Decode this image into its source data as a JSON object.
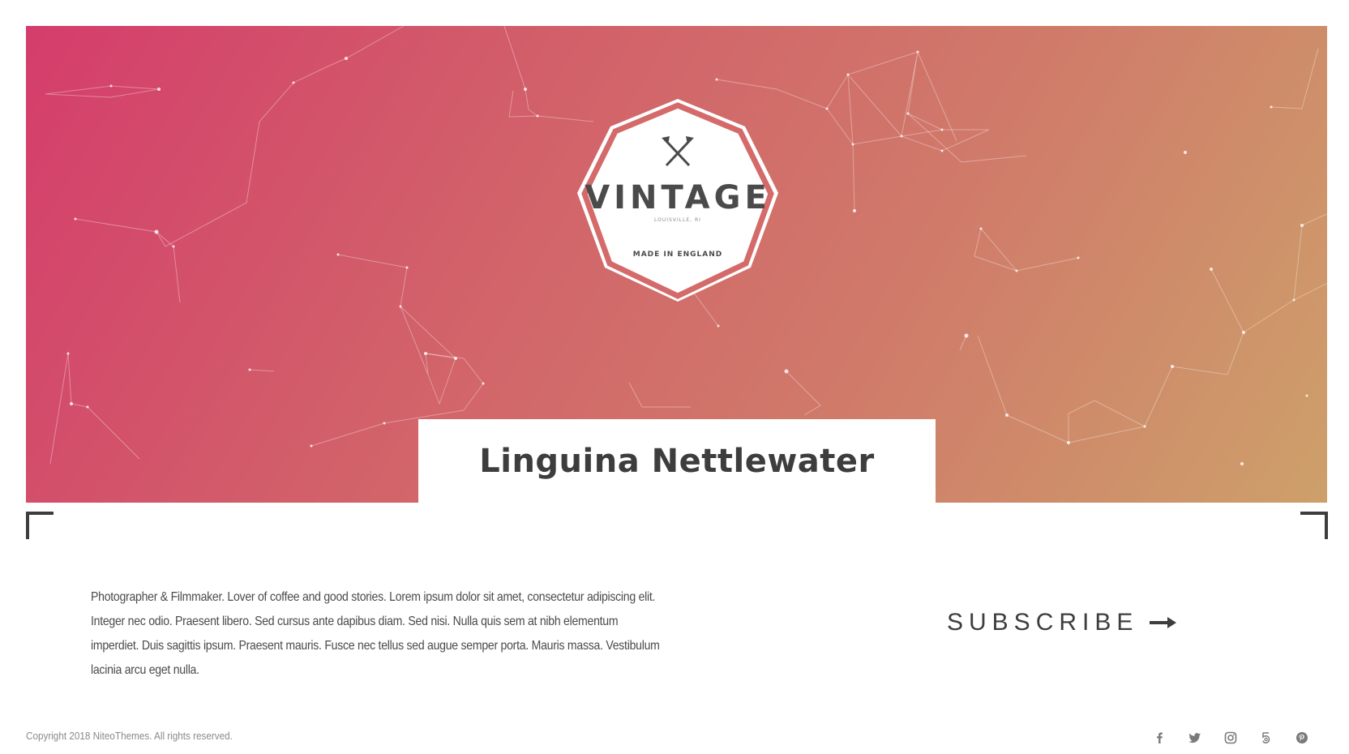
{
  "header": {
    "logo": {
      "brand": "VINTAGE",
      "location": "LOUISVILLE, RI",
      "tagline": "MADE IN ENGLAND"
    },
    "name": "Linguina Nettlewater",
    "gradient_colors": [
      "#d43d6b",
      "#cda06a"
    ]
  },
  "main": {
    "bio": "Photographer & Filmmaker. Lover of coffee and good stories. Lorem ipsum dolor sit amet, consectetur adipiscing elit. Integer nec odio. Praesent libero. Sed cursus ante dapibus diam. Sed nisi. Nulla quis sem at nibh elementum imperdiet. Duis sagittis ipsum. Praesent mauris. Fusce nec tellus sed augue semper porta. Mauris massa. Vestibulum lacinia arcu eget nulla.",
    "subscribe_label": "SUBSCRIBE",
    "subscribe_icon": "arrow-right-icon"
  },
  "footer": {
    "copyright": "Copyright 2018 NiteoThemes. All rights reserved.",
    "social": [
      {
        "name": "facebook",
        "icon": "facebook-icon"
      },
      {
        "name": "twitter",
        "icon": "twitter-icon"
      },
      {
        "name": "instagram",
        "icon": "instagram-icon"
      },
      {
        "name": "500px",
        "icon": "500px-icon"
      },
      {
        "name": "pinterest",
        "icon": "pinterest-icon"
      }
    ]
  },
  "colors": {
    "text_dark": "#3d3d3d",
    "text_muted": "#8a8a8a",
    "badge_ring": "#d46a6a"
  }
}
